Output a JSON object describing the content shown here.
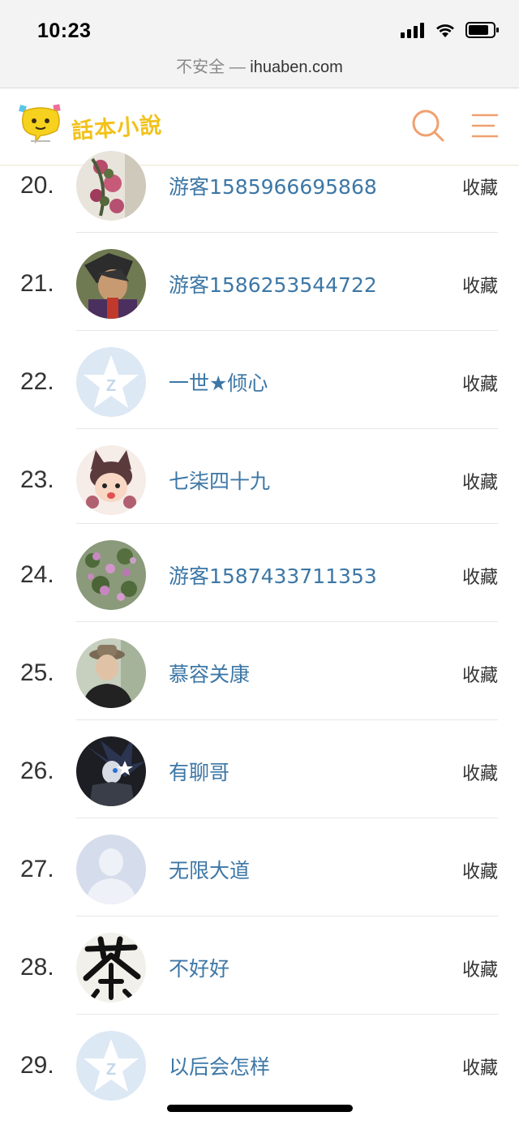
{
  "status_bar": {
    "time": "10:23"
  },
  "url_bar": {
    "security": "不安全 — ",
    "domain": "ihuaben.com"
  },
  "site": {
    "logo_text": "話本小說"
  },
  "icons": {
    "search": "search-icon",
    "menu": "menu-icon"
  },
  "colors": {
    "accent": "#f0a070",
    "link": "#3d77a6",
    "logo": "#f2c21b"
  },
  "list": [
    {
      "rank": "20.",
      "name": "游客1585966695868",
      "action": "收藏",
      "avatar": "flowers-painting-avatar"
    },
    {
      "rank": "21.",
      "name": "游客1586253544722",
      "action": "收藏",
      "avatar": "anime-character-avatar"
    },
    {
      "rank": "22.",
      "name": "一世★倾心",
      "action": "收藏",
      "avatar": "default-qzone-avatar"
    },
    {
      "rank": "23.",
      "name": "七柒四十九",
      "action": "收藏",
      "avatar": "cartoon-cat-girl-avatar"
    },
    {
      "rank": "24.",
      "name": "游客1587433711353",
      "action": "收藏",
      "avatar": "purple-flowers-avatar"
    },
    {
      "rank": "25.",
      "name": "慕容关康",
      "action": "收藏",
      "avatar": "man-with-hat-avatar"
    },
    {
      "rank": "26.",
      "name": "有聊哥",
      "action": "收藏",
      "avatar": "dark-anime-avatar"
    },
    {
      "rank": "27.",
      "name": "无限大道",
      "action": "收藏",
      "avatar": "default-person-avatar"
    },
    {
      "rank": "28.",
      "name": "不好好",
      "action": "收藏",
      "avatar": "calligraphy-tea-avatar"
    },
    {
      "rank": "29.",
      "name": "以后会怎样",
      "action": "收藏",
      "avatar": "default-qzone-avatar"
    }
  ]
}
